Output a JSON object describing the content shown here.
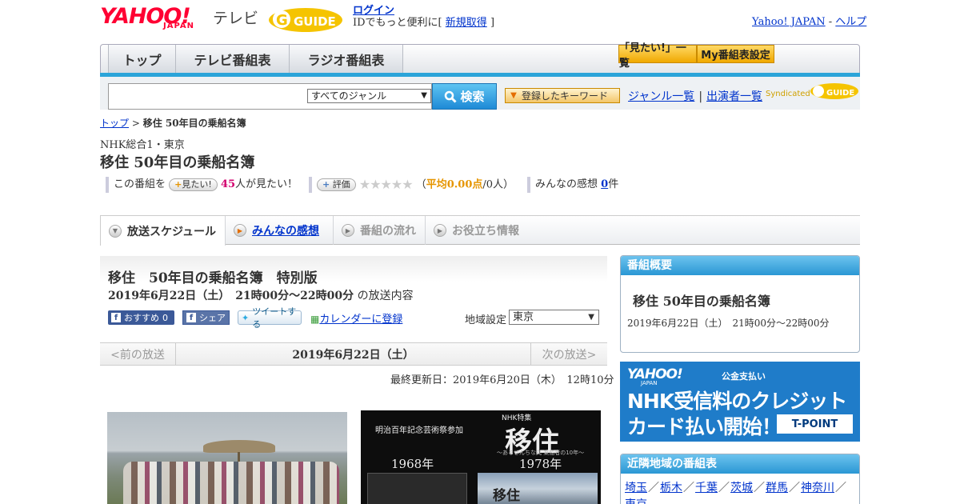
{
  "header": {
    "logo_yahoo": "YAHOO!",
    "logo_japan": "JAPAN",
    "logo_tv": "テレビ",
    "logo_gguide": "GUIDE",
    "login_link": "ログイン",
    "login_text_prefix": "IDでもっと便利に[",
    "signup_link": "新規取得",
    "login_text_suffix": "]",
    "yahoo_japan_link": "Yahoo! JAPAN",
    "separator": " - ",
    "help_link": "ヘルプ"
  },
  "nav": {
    "top": "トップ",
    "tv_schedule": "テレビ番組表",
    "radio_schedule": "ラジオ番組表",
    "mitai_list": "「見たい!」一覧",
    "my_table": "My番組表設定"
  },
  "search": {
    "input_value": "",
    "genre_selected": "すべてのジャンル",
    "search_button": "検索",
    "keyword_button": "登録したキーワード",
    "genre_list_link": "ジャンル一覧",
    "link_separator": "|",
    "cast_list_link": "出演者一覧",
    "syndicated": "Syndicated"
  },
  "breadcrumb": {
    "top": "トップ",
    "arrow": " > ",
    "current": "移住 50年目の乗船名簿"
  },
  "program": {
    "station": "NHK総合1・東京",
    "title": "移住 50年目の乗船名簿",
    "want_prefix": "この番組を",
    "want_button": "見たい!",
    "want_count": "45",
    "want_suffix": "人が見たい！",
    "rate_button": "評価",
    "stars": "★★★★★",
    "avg_paren_open": "（",
    "avg_label": "平均0.00点",
    "avg_people": "/0人）",
    "impressions_label": "みんなの感想",
    "impressions_count": "0",
    "impressions_unit": "件"
  },
  "tabs": {
    "schedule": "放送スケジュール",
    "impressions": "みんなの感想",
    "flow": "番組の流れ",
    "info": "お役立ち情報"
  },
  "detail": {
    "title": "移住　50年目の乗船名簿　特別版",
    "time": "2019年6月22日（土）　21時00分～22時00分",
    "time_suffix": "の放送内容",
    "fb_recommend": "おすすめ",
    "fb_recommend_count": "0",
    "fb_share": "シェア",
    "tweet": "ツイートする",
    "calendar": "カレンダーに登録",
    "region_label": "地域設定",
    "region_selected": "東京",
    "prev": "<前の放送",
    "current_date": "2019年6月22日（土）",
    "next": "次の放送>",
    "last_updated": "最終更新日：2019年6月20日（木）　12時10分"
  },
  "photo2": {
    "nhk_label": "NHK特集",
    "big_title": "移住",
    "subtitle": "～あるぜんちな丸 乗船者の10年～",
    "festival": "明治百年記念芸術祭参加",
    "year1": "1968年",
    "year2": "1978年",
    "small_title": "移住"
  },
  "sidebar": {
    "overview_head": "番組概要",
    "overview_title": "移住 50年目の乗船名簿",
    "overview_time": "2019年6月22日（土）　21時00分～22時00分",
    "ad_yahoo": "YAHOO!",
    "ad_japan": "JAPAN",
    "ad_koukin": "公金支払い",
    "ad_line1": "NHK受信料のクレジット",
    "ad_line2": "カード払い開始！",
    "ad_tpoint": "T-POINT",
    "nearby_head": "近隣地域の番組表",
    "nearby": [
      "埼玉",
      "栃木",
      "千葉",
      "茨城",
      "群馬",
      "神奈川",
      "東京"
    ]
  },
  "colors": {
    "yahoo_red": "#ff0033",
    "accent_blue": "#2ba4d9",
    "link_blue": "#0033cc",
    "want_magenta": "#d2006e",
    "avg_orange": "#e69500"
  }
}
